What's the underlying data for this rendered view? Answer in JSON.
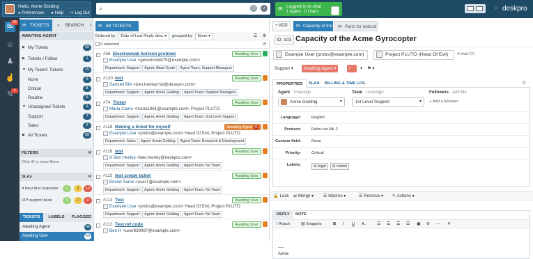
{
  "header": {
    "greeting": "Hello, Annie Golding",
    "links": [
      "Preferences",
      "Help",
      "Log Out"
    ],
    "chat_line1": "Logged in to chat",
    "chat_line2": "1 Agent · 0 Users",
    "brand": "deskpro"
  },
  "rail": {
    "badges": [
      "36",
      "4"
    ]
  },
  "left": {
    "tabs": [
      "TICKETS",
      "SEARCH"
    ],
    "awaiting_header": "AWAITING AGENT",
    "rows": [
      {
        "label": "My Tickets",
        "count": "20"
      },
      {
        "label": "Tickets I Follow",
        "count": "1"
      },
      {
        "label": "My Teams' Tickets",
        "count": "15"
      },
      {
        "label": "None",
        "count": "9"
      },
      {
        "label": "Critical",
        "count": "8"
      },
      {
        "label": "Routine",
        "count": "6"
      },
      {
        "label": "Unassigned Tickets",
        "count": "9"
      },
      {
        "label": "Support",
        "count": "7"
      },
      {
        "label": "Sales",
        "count": "2"
      },
      {
        "label": "All Tickets",
        "count": "36"
      }
    ],
    "filters_header": "FILTERS",
    "filters_hint": "Click ⚙ to show filters",
    "slas_header": "SLAs",
    "slas": [
      {
        "label": "4 hour first response",
        "a": "1",
        "b": "2",
        "c": "12"
      },
      {
        "label": "VIP support level",
        "a": "0",
        "b": "2",
        "c": "0"
      }
    ],
    "bottom_tabs": [
      "TICKETS",
      "LABELS",
      "FLAGGED"
    ],
    "bottom_rows": [
      {
        "label": "Awaiting Agent",
        "count": "36"
      },
      {
        "label": "Awaiting User",
        "count": "69"
      }
    ]
  },
  "list": {
    "tab": "69 TICKETS",
    "ordered_by": "Ordered by",
    "order_value": "Date of Last Reply",
    "order_dir": "desc",
    "grouped_by": "grouped by",
    "group_value": "None",
    "selected": "0 selected",
    "tickets": [
      {
        "num": "#56",
        "title": "Electroweak horizon problem",
        "from": "Example User",
        "email": "<generictodd75@example.com>",
        "tags": [
          "Department: Support",
          "Agent: Abad Syrah",
          "Agent Team: Support Managers"
        ],
        "status": "Awaiting User"
      },
      {
        "num": "#120",
        "title": "test",
        "from": "Samuel Blix",
        "email": "<ben.henley+sb@deskpro.com>",
        "tags": [
          "Department: Support",
          "Agent: Annie Golding",
          "Agent Team: Support Managers"
        ],
        "status": "Awaiting User"
      },
      {
        "num": "#74",
        "title": "Ticket",
        "from": "Maria Cama",
        "email": "<maria1961@example.com> Project PLUTO",
        "tags": [
          "Department: Support",
          "Agent: Annie Golding",
          "Agent Team: 2nd Level Support"
        ],
        "status": "Awaiting User"
      },
      {
        "num": "#118",
        "title": "Making a ticket for myself",
        "from": "Example User",
        "email": "<probs@example.com> Head Of Evil, Project PLUTO",
        "tags": [
          "Department: Sales",
          "Agent: Annie Golding",
          "Agent Team: Research & Development"
        ],
        "status": "Awaiting Agent",
        "count": "6"
      },
      {
        "num": "#116",
        "title": "test",
        "from": "X Ben Henley",
        "email": "<ben.henley@deskpro.com>",
        "tags": [
          "Department: Support",
          "Agent: Annie Golding",
          "Agent Team: No Team"
        ],
        "status": "Awaiting User"
      },
      {
        "num": "#115",
        "title": "test create ticket",
        "from": "Emold Same",
        "email": "<user7@example.com>",
        "tags": [
          "Department: Support",
          "Agent: Annie Golding",
          "Agent Team: No Team"
        ],
        "status": "Awaiting User"
      },
      {
        "num": "#113",
        "title": "Test",
        "from": "Example User",
        "email": "<probs@example.com> Head Of Evil, Project PLUTO",
        "tags": [
          "Department: Support",
          "Agent: Annie Golding",
          "Agent Team: No Team"
        ],
        "status": "Awaiting User"
      },
      {
        "num": "#112",
        "title": "Test ref code",
        "from": "Ben H",
        "email": "<user839087@example.com>",
        "tags": [],
        "status": "Awaiting User"
      }
    ]
  },
  "detail": {
    "add": "ADD",
    "tabs": [
      "Capacity of the",
      "Parts for redund"
    ],
    "id": "ID: 103",
    "title": "Capacity of the Acme Gyrocopter",
    "person": "Example User (probs@example.com)",
    "org": "Project PLUTO (Head Of Evil)",
    "add_cc": "Add CC",
    "dept": "Support",
    "status": "Awaiting Agent",
    "prop_tabs": [
      "PROPERTIES",
      "SLAS",
      "BILLING & TIME LOG"
    ],
    "agent_label": "Agent",
    "agent_sub": "Unassign",
    "agent_value": "Annie Golding",
    "team_label": "Team",
    "team_sub": "Unassign",
    "team_value": "1st Level Support",
    "followers_label": "Followers",
    "followers_sub": "Add Me",
    "add_follower": "Add a follower",
    "fields": [
      {
        "k": "Language:",
        "v": "English"
      },
      {
        "k": "Product:",
        "v": "Robo-cat Mk 2"
      },
      {
        "k": "Custom field:",
        "v": "None"
      },
      {
        "k": "Priority:",
        "v": "Critical"
      }
    ],
    "labels_key": "Labels:",
    "labels": [
      "legal",
      "rocket"
    ],
    "actions": [
      "Lock",
      "Merge",
      "Macros",
      "Remove",
      "Actions"
    ],
    "reply_tabs": [
      "REPLY",
      "NOTE"
    ],
    "editor": [
      "Attach",
      "Snippets"
    ],
    "sig_line": "----",
    "sig_name": "Annie"
  }
}
